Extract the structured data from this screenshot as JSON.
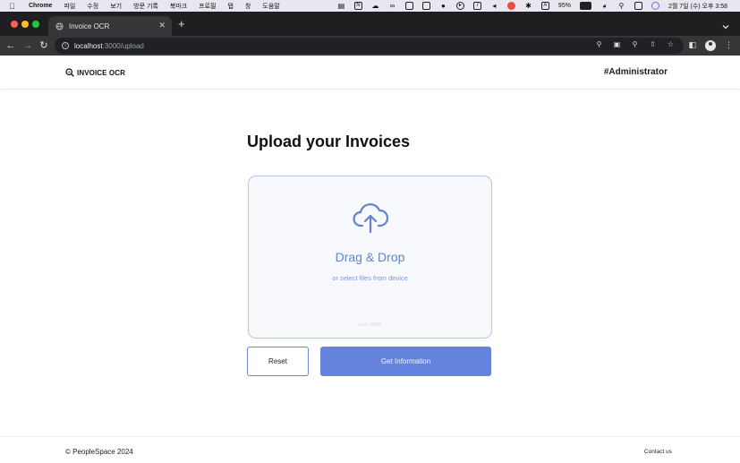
{
  "menubar": {
    "app": "Chrome",
    "menus": [
      "파일",
      "수정",
      "보기",
      "방문 기록",
      "북마크",
      "프로필",
      "탭",
      "창",
      "도움말"
    ],
    "battery": "95%",
    "datetime": "2월 7일 (수) 오후 3:58",
    "status_icons": [
      "figma-icon",
      "notion-icon",
      "cloud-icon",
      "glasses-icon",
      "display-icon",
      "monitor-icon",
      "cat-icon",
      "play-icon",
      "calendar-icon",
      "volume-icon",
      "vpn-icon",
      "bluetooth-icon",
      "input-source-icon",
      "wifi-icon",
      "search-icon",
      "control-center-icon",
      "siri-icon"
    ],
    "input_label": "A",
    "calendar_label": "7"
  },
  "browser": {
    "tab_title": "Invoice OCR",
    "url_host": "localhost",
    "url_path": ":3000/upload",
    "colors": {
      "tab_bg": "#353638",
      "strip_bg": "#1f1f21"
    }
  },
  "site": {
    "brand": "INVOICE OCR",
    "user": "#Administrator",
    "heading": "Upload your Invoices",
    "dropzone": {
      "title": "Drag & Drop",
      "subtitle": "or select files from device",
      "max": "max. 50MB"
    },
    "buttons": {
      "reset": "Reset",
      "get_info": "Get Information"
    },
    "footer": {
      "copyright": "© PeopleSpace 2024",
      "contact": "Contact us"
    },
    "colors": {
      "accent": "#6583dc",
      "dropzone_border": "#b4c3e6",
      "dropzone_text": "#6283d0"
    }
  }
}
